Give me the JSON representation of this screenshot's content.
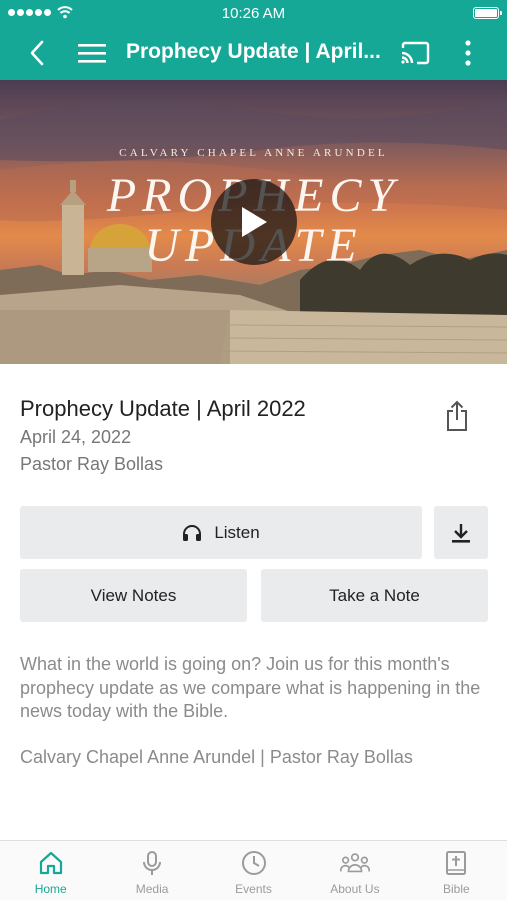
{
  "status_bar": {
    "time": "10:26 AM"
  },
  "app_bar": {
    "title": "Prophecy Update | April..."
  },
  "hero": {
    "kicker": "CALVARY CHAPEL ANNE ARUNDEL",
    "title_line1": "PROPHECY",
    "title_line2": "UPDATE"
  },
  "sermon": {
    "title": "Prophecy Update | April 2022",
    "date": "April 24, 2022",
    "speaker": "Pastor Ray Bollas"
  },
  "actions": {
    "listen_label": "Listen",
    "view_notes_label": "View Notes",
    "take_note_label": "Take a Note"
  },
  "description": {
    "body": "What in the world is going on?  Join us for this month's prophecy update as we compare what is happening in the news today with the Bible.",
    "credit": "Calvary Chapel Anne Arundel | Pastor Ray Bollas"
  },
  "tabs": [
    {
      "label": "Home",
      "icon": "home-icon",
      "active": true
    },
    {
      "label": "Media",
      "icon": "microphone-icon",
      "active": false
    },
    {
      "label": "Events",
      "icon": "clock-icon",
      "active": false
    },
    {
      "label": "About Us",
      "icon": "group-icon",
      "active": false
    },
    {
      "label": "Bible",
      "icon": "bible-icon",
      "active": false
    }
  ],
  "colors": {
    "accent": "#16a897",
    "button_bg": "#e9ebec"
  }
}
